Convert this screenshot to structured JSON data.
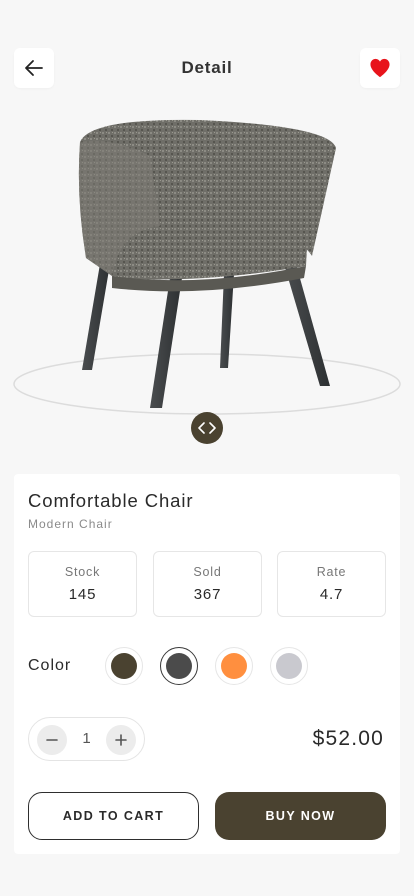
{
  "header": {
    "title": "Detail"
  },
  "product": {
    "name": "Comfortable Chair",
    "subtitle": "Modern Chair"
  },
  "stats": [
    {
      "label": "Stock",
      "value": "145"
    },
    {
      "label": "Sold",
      "value": "367"
    },
    {
      "label": "Rate",
      "value": "4.7"
    }
  ],
  "colors": {
    "label": "Color",
    "options": [
      {
        "name": "dark-olive",
        "hex": "#4a4230",
        "selected": false
      },
      {
        "name": "charcoal",
        "hex": "#4b4b4b",
        "selected": true
      },
      {
        "name": "orange",
        "hex": "#ff8f3f",
        "selected": false
      },
      {
        "name": "light-gray",
        "hex": "#c9c9cf",
        "selected": false
      }
    ]
  },
  "quantity": {
    "value": "1"
  },
  "price": "$52.00",
  "actions": {
    "add_to_cart": "ADD TO CART",
    "buy_now": "BUY NOW"
  },
  "theme": {
    "accent": "#4a4230",
    "favorite": "#e8141c"
  },
  "icons": [
    "arrow-left-icon",
    "heart-icon",
    "chevron-left-right-icon",
    "minus-icon",
    "plus-icon"
  ]
}
